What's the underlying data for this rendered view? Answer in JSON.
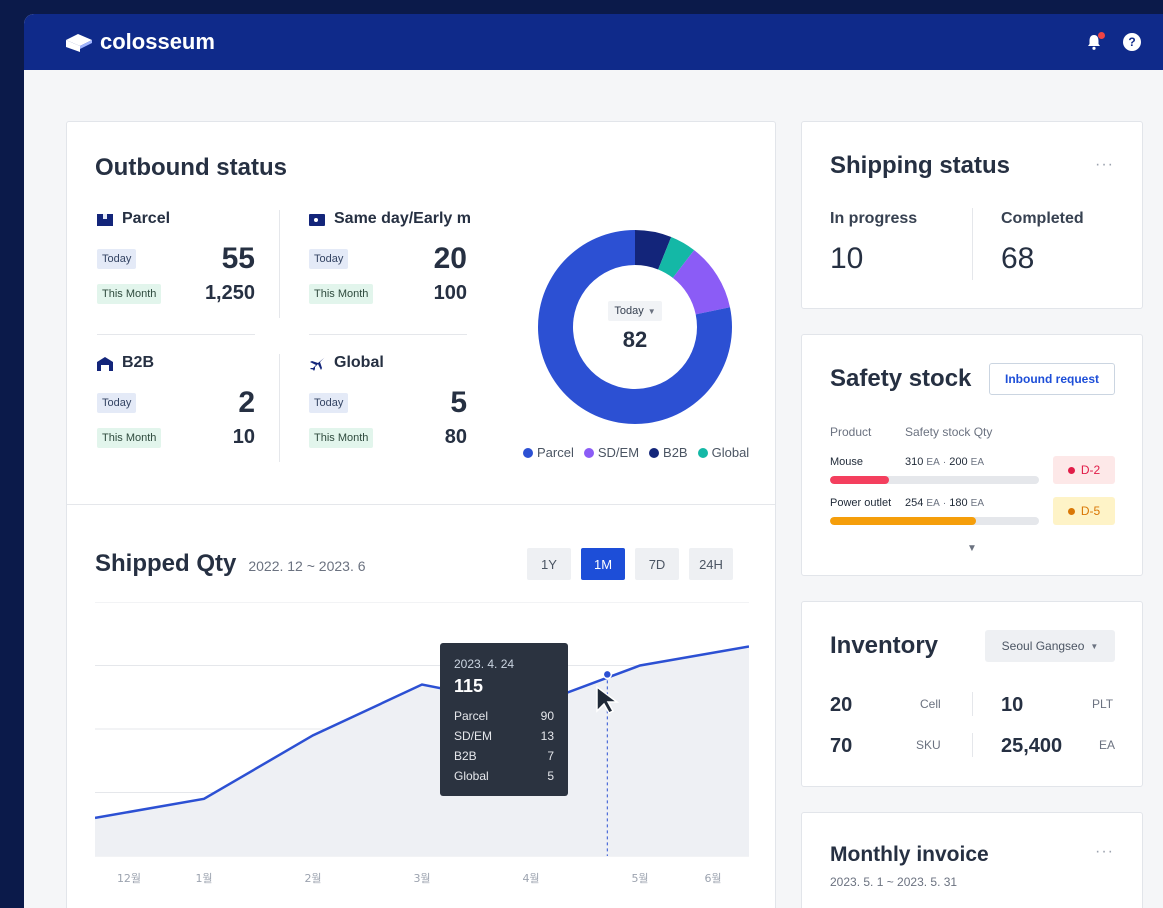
{
  "app": {
    "brand": "colosseum"
  },
  "outbound": {
    "title": "Outbound status",
    "today_tag": "Today",
    "month_tag": "This Month",
    "metrics": [
      {
        "name": "Parcel",
        "today": "55",
        "month": "1,250"
      },
      {
        "name": "Same day/Early m",
        "today": "20",
        "month": "100"
      },
      {
        "name": "B2B",
        "today": "2",
        "month": "10"
      },
      {
        "name": "Global",
        "today": "5",
        "month": "80"
      }
    ],
    "donut": {
      "selector": "Today",
      "total": "82",
      "legend": [
        "Parcel",
        "SD/EM",
        "B2B",
        "Global"
      ],
      "colors": {
        "Parcel": "#2c50d3",
        "SD/EM": "#8b5cf6",
        "B2B": "#13257a",
        "Global": "#14b8a6"
      }
    }
  },
  "shipped": {
    "title": "Shipped Qty",
    "range": "2022. 12 ~ 2023. 6",
    "buttons": [
      "1Y",
      "1M",
      "7D",
      "24H"
    ],
    "active": "1M",
    "tooltip": {
      "date": "2023. 4. 24",
      "total": "115",
      "rows": [
        {
          "label": "Parcel",
          "value": "90"
        },
        {
          "label": "SD/EM",
          "value": "13"
        },
        {
          "label": "B2B",
          "value": "7"
        },
        {
          "label": "Global",
          "value": "5"
        }
      ]
    }
  },
  "chart_data": {
    "type": "line",
    "categories": [
      "12월",
      "1월",
      "2월",
      "3월",
      "4월",
      "5월",
      "6월"
    ],
    "x_labels": [
      "12월",
      "1월",
      "2월",
      "3월",
      "4월",
      "5월",
      "6월"
    ],
    "series": [
      {
        "values": [
          30,
          45,
          95,
          135,
          118,
          150,
          165
        ]
      }
    ],
    "ylim": [
      0,
      200
    ],
    "grid": true,
    "highlight": {
      "x": "2023. 4. 24",
      "y": 115
    }
  },
  "shipping": {
    "title": "Shipping status",
    "in_progress_label": "In progress",
    "in_progress": "10",
    "completed_label": "Completed",
    "completed": "68"
  },
  "safety": {
    "title": "Safety stock",
    "button": "Inbound request",
    "col_product": "Product",
    "col_qty": "Safety stock Qty",
    "items": [
      {
        "product": "Mouse",
        "qty1": "310",
        "qty2": "200",
        "unit": "EA",
        "fill": 0.28,
        "color": "#f43f5e",
        "badge": "D-2",
        "badge_bg": "#fde8e8",
        "badge_fg": "#e11d48"
      },
      {
        "product": "Power outlet",
        "qty1": "254",
        "qty2": "180",
        "unit": "EA",
        "fill": 0.7,
        "color": "#f59e0b",
        "badge": "D-5",
        "badge_bg": "#fef3c7",
        "badge_fg": "#d97706"
      }
    ],
    "sep": "·"
  },
  "inventory": {
    "title": "Inventory",
    "warehouse": "Seoul Gangseo",
    "cells": [
      {
        "value": "20",
        "unit": "Cell"
      },
      {
        "value": "10",
        "unit": "PLT"
      },
      {
        "value": "70",
        "unit": "SKU"
      },
      {
        "value": "25,400",
        "unit": "EA"
      }
    ]
  },
  "invoice": {
    "title": "Monthly invoice",
    "range": "2023. 5. 1 ~ 2023. 5. 31"
  },
  "more": "···"
}
